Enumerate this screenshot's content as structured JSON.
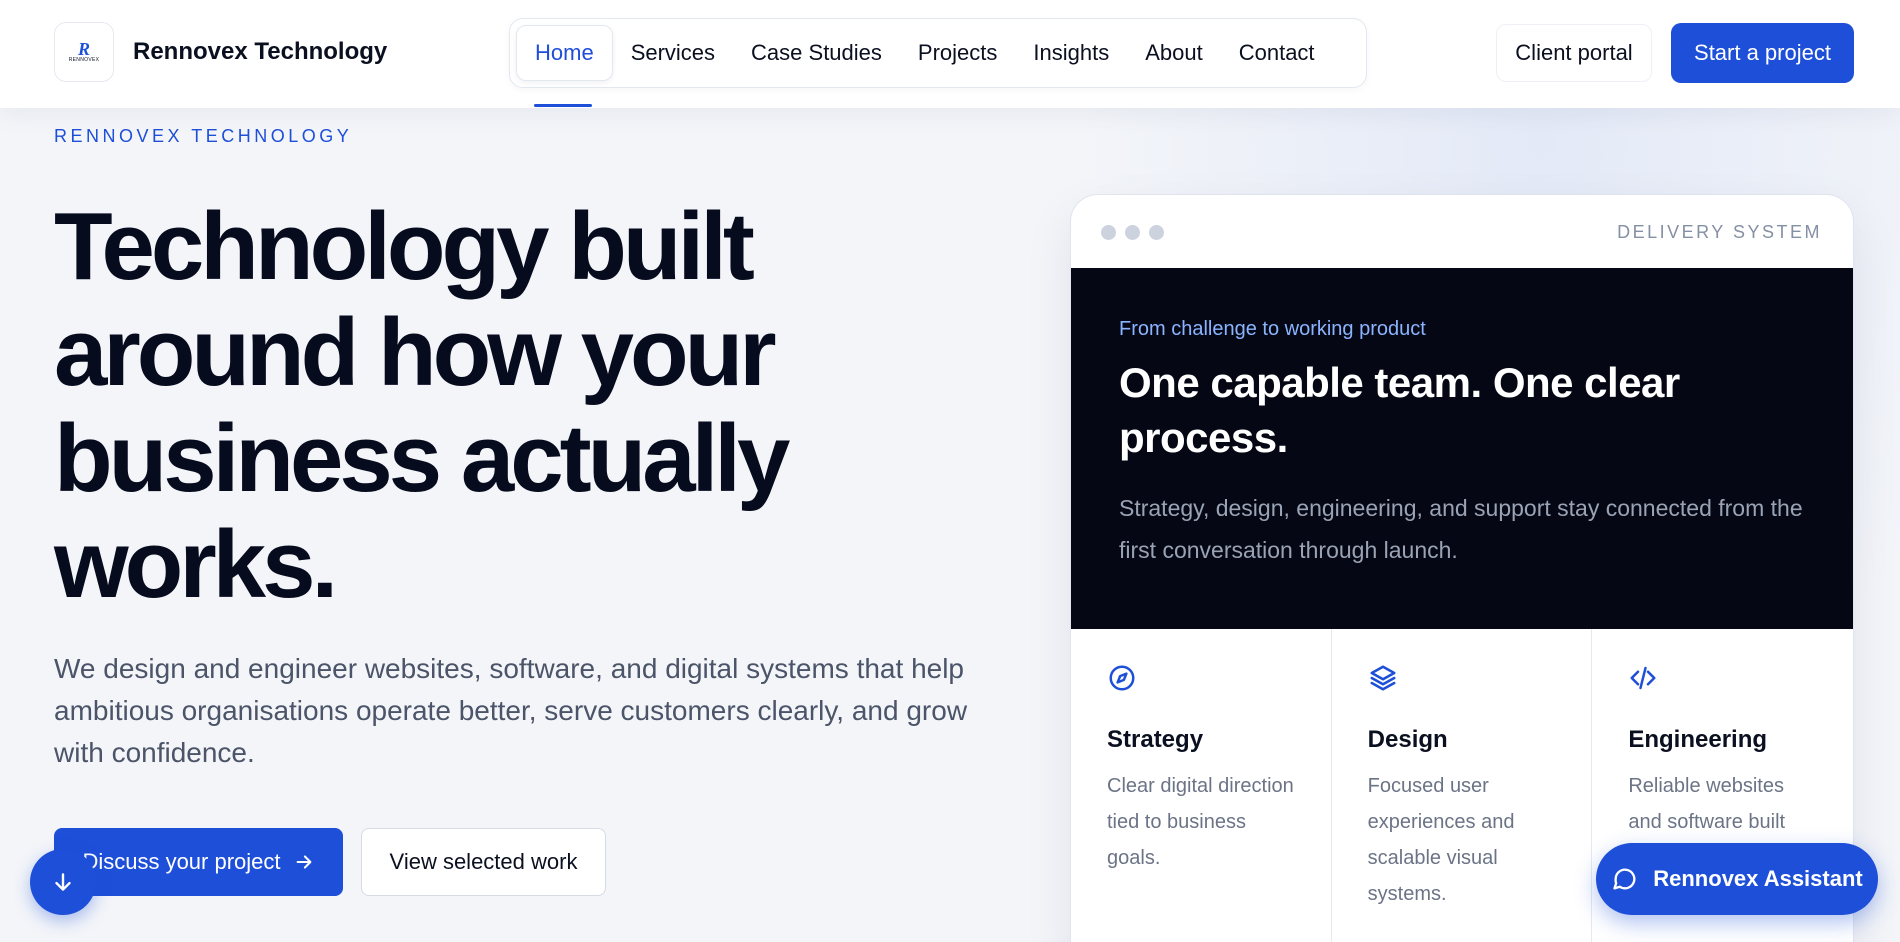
{
  "header": {
    "brand_name": "Rennovex Technology",
    "logo_text": "R",
    "logo_subtext": "RENNOVEX",
    "nav": [
      {
        "label": "Home",
        "active": true
      },
      {
        "label": "Services"
      },
      {
        "label": "Case Studies"
      },
      {
        "label": "Projects"
      },
      {
        "label": "Insights"
      },
      {
        "label": "About"
      },
      {
        "label": "Contact"
      }
    ],
    "client_portal_label": "Client portal",
    "start_project_label": "Start a project"
  },
  "hero": {
    "eyebrow": "RENNOVEX TECHNOLOGY",
    "title": "Technology built around how your business actually works.",
    "subtitle": "We design and engineer websites, software, and digital systems that help ambitious organisations operate better, serve customers clearly, and grow with confidence.",
    "primary_cta": "Discuss your project",
    "secondary_cta": "View selected work"
  },
  "card": {
    "label": "DELIVERY SYSTEM",
    "kicker": "From challenge to working product",
    "title": "One capable team. One clear process.",
    "description": "Strategy, design, engineering, and support stay connected from the first conversation through launch.",
    "columns": [
      {
        "icon": "compass-icon",
        "title": "Strategy",
        "desc": "Clear digital direction tied to business goals."
      },
      {
        "icon": "layers-icon",
        "title": "Design",
        "desc": "Focused user experiences and scalable visual systems."
      },
      {
        "icon": "code-icon",
        "title": "Engineering",
        "desc": "Reliable websites and software built"
      }
    ]
  },
  "assistant_label": "Rennovex Assistant",
  "colors": {
    "accent": "#1e4fd8",
    "dark": "#050814",
    "text": "#0b1020",
    "muted": "#4b5468"
  }
}
